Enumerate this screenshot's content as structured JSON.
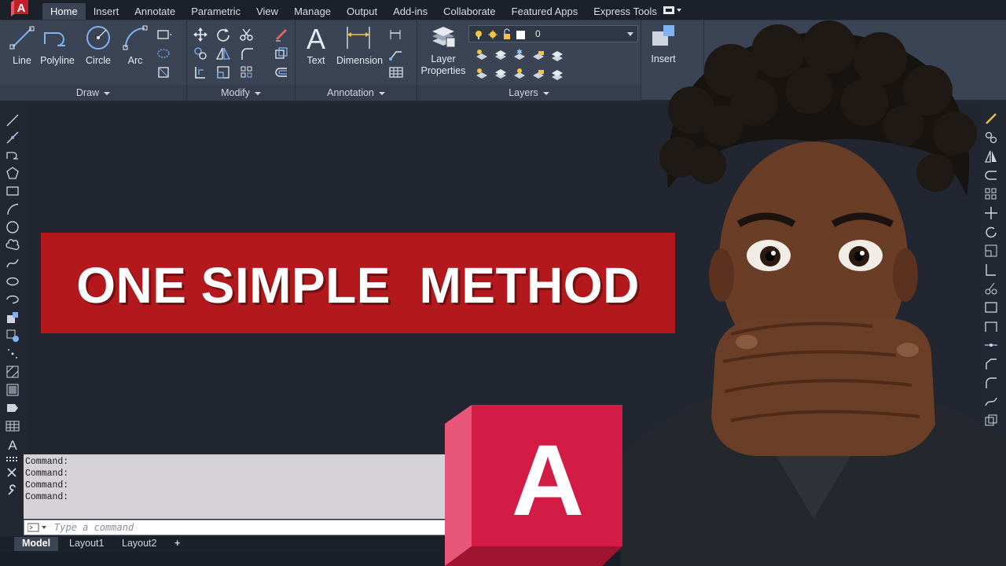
{
  "menu": {
    "tabs": [
      {
        "label": "Home",
        "active": true
      },
      {
        "label": "Insert"
      },
      {
        "label": "Annotate"
      },
      {
        "label": "Parametric"
      },
      {
        "label": "View"
      },
      {
        "label": "Manage"
      },
      {
        "label": "Output"
      },
      {
        "label": "Add-ins"
      },
      {
        "label": "Collaborate"
      },
      {
        "label": "Featured Apps"
      },
      {
        "label": "Express Tools"
      }
    ]
  },
  "ribbon": {
    "draw": {
      "line": "Line",
      "polyline": "Polyline",
      "circle": "Circle",
      "arc": "Arc",
      "footer": "Draw"
    },
    "modify": {
      "footer": "Modify"
    },
    "annotation": {
      "text": "Text",
      "dimension": "Dimension",
      "footer": "Annotation"
    },
    "layers": {
      "layer_properties": "Layer Properties",
      "current_layer": "0",
      "footer": "Layers"
    },
    "block": {
      "insert": "Insert"
    }
  },
  "banner": {
    "text": "ONE SIMPLE  METHOD"
  },
  "command": {
    "history": [
      "Command:",
      "Command:",
      "Command:",
      "Command:"
    ],
    "placeholder": "Type a command"
  },
  "layout_tabs": [
    {
      "label": "Model",
      "active": true
    },
    {
      "label": "Layout1"
    },
    {
      "label": "Layout2"
    },
    {
      "label": "+"
    }
  ],
  "logo": {
    "letter": "A"
  },
  "colors": {
    "banner": "#b3191c",
    "logo_front": "#d21b45",
    "logo_side": "#e8577a",
    "ribbon": "#3b4455",
    "canvas": "#212631"
  }
}
